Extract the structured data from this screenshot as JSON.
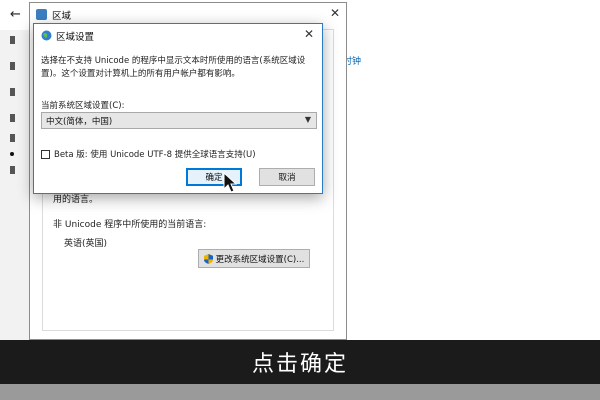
{
  "background_window": {
    "back_icon": "back-arrow-icon",
    "right_link_fragment": "时钟"
  },
  "region_window": {
    "title": "区域",
    "close_glyph": "✕",
    "text_fragment_1": "用的语言。",
    "nonunicode_label": "非 Unicode 程序中所使用的当前语言:",
    "nonunicode_value": "英语(英国)",
    "change_locale_button": "更改系统区域设置(C)..."
  },
  "dialog": {
    "title": "区域设置",
    "close_glyph": "✕",
    "description": "选择在不支持 Unicode 的程序中显示文本时所使用的语言(系统区域设置)。这个设置对计算机上的所有用户帐户都有影响。",
    "current_locale_label": "当前系统区域设置(C):",
    "selected_locale": "中文(简体，中国)",
    "beta_label": "Beta 版: 使用 Unicode UTF-8 提供全球语言支持(U)",
    "beta_checked": false,
    "ok_label": "确定",
    "cancel_label": "取消"
  },
  "caption": "点击确定",
  "colors": {
    "accent": "#0078d7",
    "caption_bg": "#1b1b1b"
  }
}
